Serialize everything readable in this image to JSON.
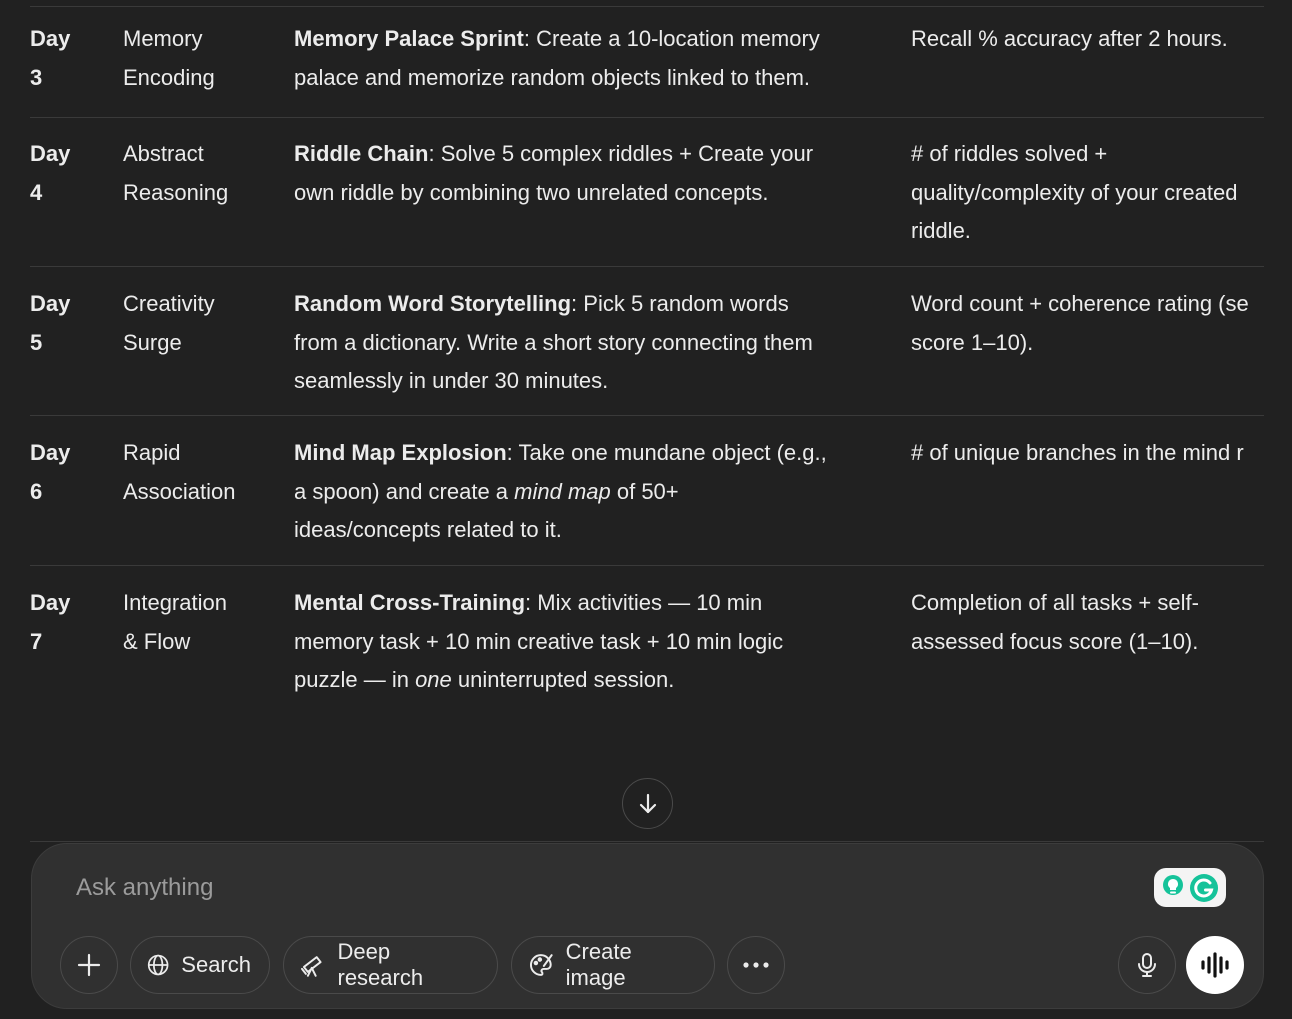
{
  "table": {
    "rows": [
      {
        "day": [
          "Day",
          "3"
        ],
        "focus": [
          "Memory",
          "Encoding"
        ],
        "challenge_bold": "Memory Palace Sprint",
        "challenge_lines": [
          "Create a 10-location memory",
          "palace and memorize random objects linked to them."
        ],
        "metric_lines": [
          "Recall % accuracy after 2 hours."
        ]
      },
      {
        "day": [
          "Day",
          "4"
        ],
        "focus": [
          "Abstract",
          "Reasoning"
        ],
        "challenge_bold": "Riddle Chain",
        "challenge_lines": [
          "Solve 5 complex riddles + Create your",
          "own riddle by combining two unrelated concepts."
        ],
        "metric_lines": [
          "# of riddles solved +",
          "quality/complexity of your created",
          "riddle."
        ]
      },
      {
        "day": [
          "Day",
          "5"
        ],
        "focus": [
          "Creativity",
          "Surge"
        ],
        "challenge_bold": "Random Word Storytelling",
        "challenge_lines": [
          "Pick 5 random words",
          "from a dictionary. Write a short story connecting them",
          "seamlessly in under 30 minutes."
        ],
        "metric_lines": [
          "Word count + coherence rating (se",
          "score 1–10)."
        ]
      },
      {
        "day": [
          "Day",
          "6"
        ],
        "focus": [
          "Rapid",
          "Association"
        ],
        "challenge_bold": "Mind Map Explosion",
        "challenge_parts": {
          "line1": "Take one mundane object (e.g.,",
          "line2_pre": "a spoon) and create a ",
          "line2_em": "mind map",
          "line2_post": " of 50+",
          "line3": "ideas/concepts related to it."
        },
        "metric_lines": [
          "# of unique branches in the mind r"
        ]
      },
      {
        "day": [
          "Day",
          "7"
        ],
        "focus": [
          "Integration",
          "& Flow"
        ],
        "challenge_bold": "Mental Cross-Training",
        "challenge_parts": {
          "line1": "Mix activities — 10 min",
          "line2": "memory task + 10 min creative task + 10 min logic",
          "line3_pre": "puzzle — in ",
          "line3_em": "one",
          "line3_post": " uninterrupted session."
        },
        "metric_lines": [
          "Completion of all tasks + self-",
          "assessed focus score (1–10)."
        ]
      }
    ]
  },
  "composer": {
    "placeholder": "Ask anything",
    "tools": {
      "search": "Search",
      "deep_research": "Deep research",
      "create_image": "Create image"
    }
  },
  "icons": {
    "scroll": "arrow-down-icon",
    "plus": "plus-icon",
    "search": "globe-icon",
    "deep": "telescope-icon",
    "image": "palette-icon",
    "more": "ellipsis-icon",
    "mic": "microphone-icon",
    "voice": "voice-wave-icon",
    "grammarly": "grammarly-icon"
  },
  "colors": {
    "background": "#212121",
    "composer": "#303030",
    "grammarly_green": "#15C39A"
  }
}
